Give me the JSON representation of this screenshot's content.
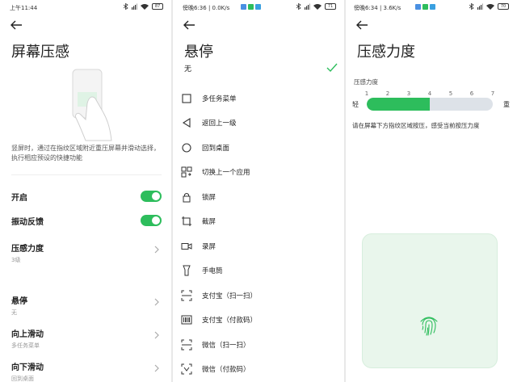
{
  "colors": {
    "accent": "#2dbd5c",
    "track": "#dde2e8",
    "pad_bg": "#e9f6ec"
  },
  "screen1": {
    "status_time": "上午11:44",
    "battery": "87",
    "title": "屏幕压感",
    "description": "竖屏时，通过在指纹区域附近重压屏幕并滑动选择，执行相应预设的快捷功能",
    "settings": [
      {
        "label": "开启",
        "toggle": true
      },
      {
        "label": "振动反馈",
        "toggle": true
      },
      {
        "label": "压感力度",
        "sub": "3级"
      },
      {
        "label": "悬停",
        "sub": "无"
      },
      {
        "label": "向上滑动",
        "sub": "多任务菜单"
      },
      {
        "label": "向下滑动",
        "sub": "回到桌面"
      }
    ]
  },
  "screen2": {
    "status_time": "傍晚6:36 | 0.0K/s",
    "battery": "71",
    "title": "悬停",
    "none_label": "无",
    "items": [
      {
        "label": "多任务菜单",
        "icon": "square-icon"
      },
      {
        "label": "返回上一级",
        "icon": "back-triangle-icon"
      },
      {
        "label": "回到桌面",
        "icon": "circle-icon"
      },
      {
        "label": "切换上一个应用",
        "icon": "app-switch-icon"
      },
      {
        "label": "锁屏",
        "icon": "lock-icon"
      },
      {
        "label": "截屏",
        "icon": "crop-icon"
      },
      {
        "label": "录屏",
        "icon": "video-icon"
      },
      {
        "label": "手电筒",
        "icon": "flashlight-icon"
      },
      {
        "label": "支付宝（扫一扫）",
        "icon": "scan-icon"
      },
      {
        "label": "支付宝（付款码）",
        "icon": "barcode-icon"
      },
      {
        "label": "微信（扫一扫）",
        "icon": "scan-icon"
      },
      {
        "label": "微信（付款码）",
        "icon": "barcode-icon"
      }
    ]
  },
  "screen3": {
    "status_time": "傍晚6:34 | 3.6K/s",
    "battery": "70",
    "title": "压感力度",
    "section_label": "压感力度",
    "levels": [
      "1",
      "2",
      "3",
      "4",
      "5",
      "6",
      "7"
    ],
    "current_level": 4,
    "max_level": 7,
    "light_label": "轻",
    "heavy_label": "重",
    "hint": "请在屏幕下方指纹区域按压，感受当前按压力度"
  }
}
